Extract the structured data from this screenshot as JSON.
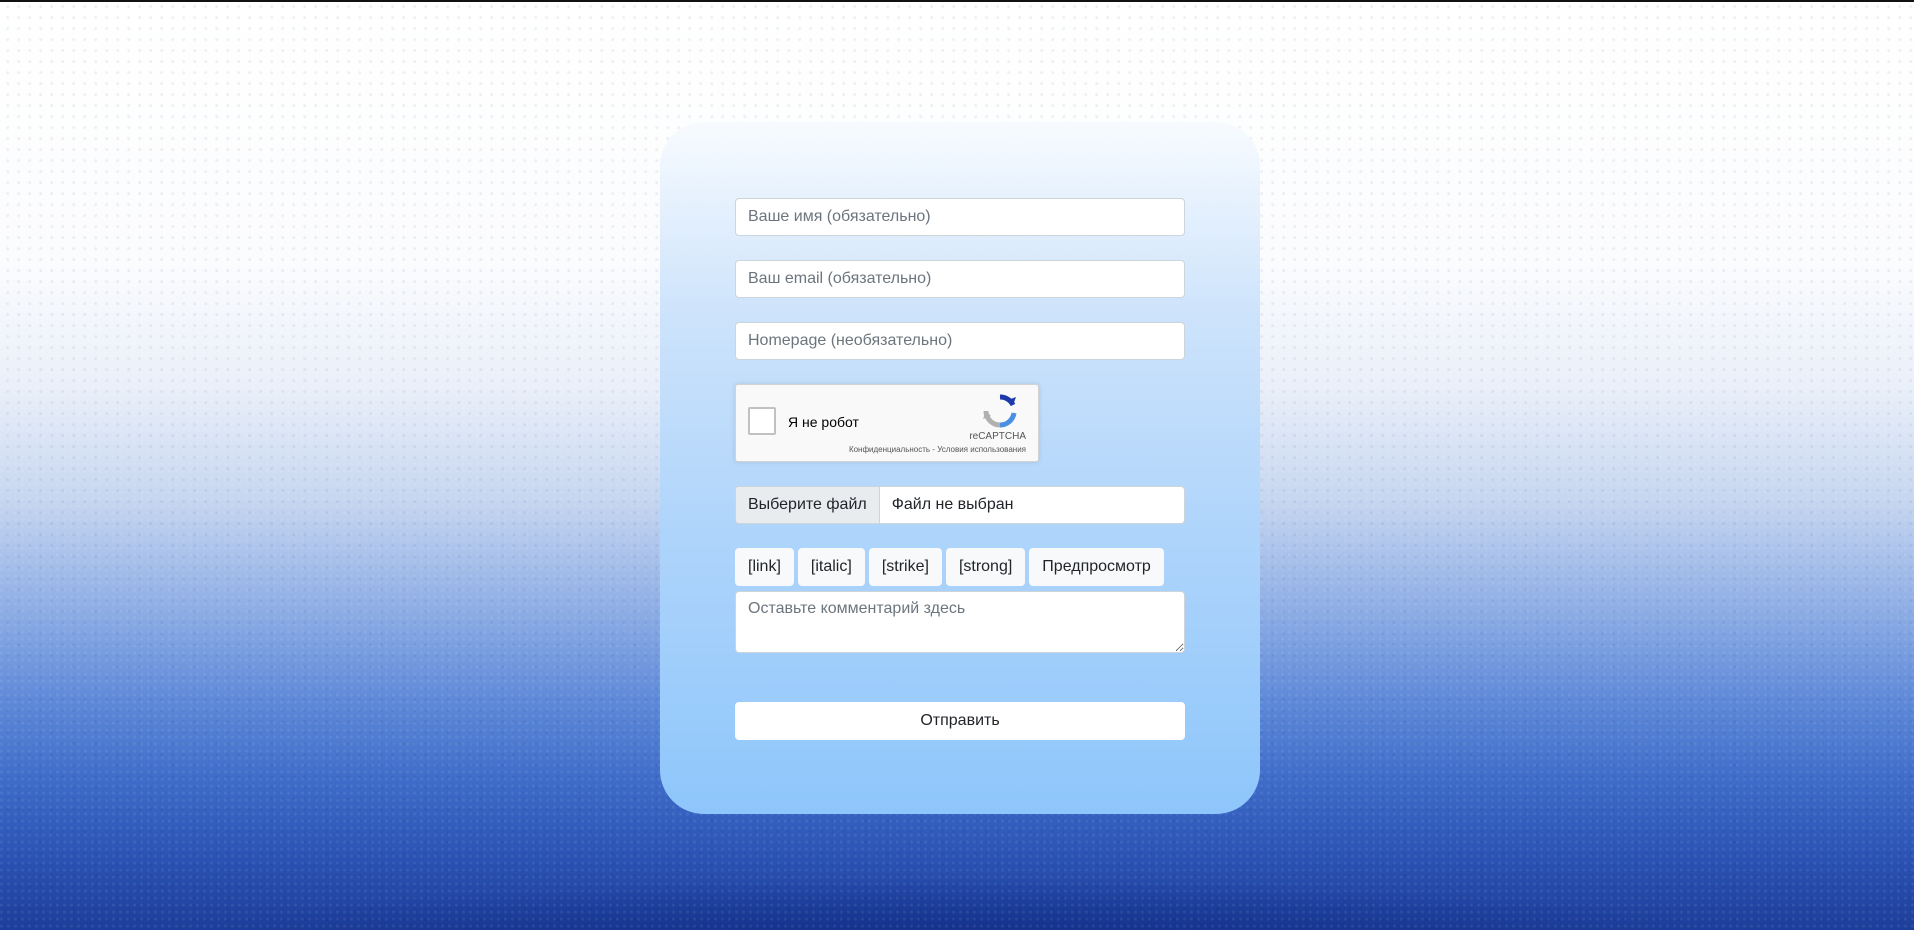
{
  "form": {
    "name_placeholder": "Ваше имя (обязательно)",
    "email_placeholder": "Ваш email (обязательно)",
    "homepage_placeholder": "Homepage (необязательно)",
    "recaptcha": {
      "label": "Я не робот",
      "brand": "reCAPTCHA",
      "links": "Конфиденциальность - Условия использования"
    },
    "file": {
      "button_label": "Выберите файл",
      "status": "Файл не выбран"
    },
    "toolbar": {
      "link": "[link]",
      "italic": "[italic]",
      "strike": "[strike]",
      "strong": "[strong]",
      "preview": "Предпросмотр"
    },
    "comment_placeholder": "Оставьте комментарий здесь",
    "submit_label": "Отправить"
  }
}
